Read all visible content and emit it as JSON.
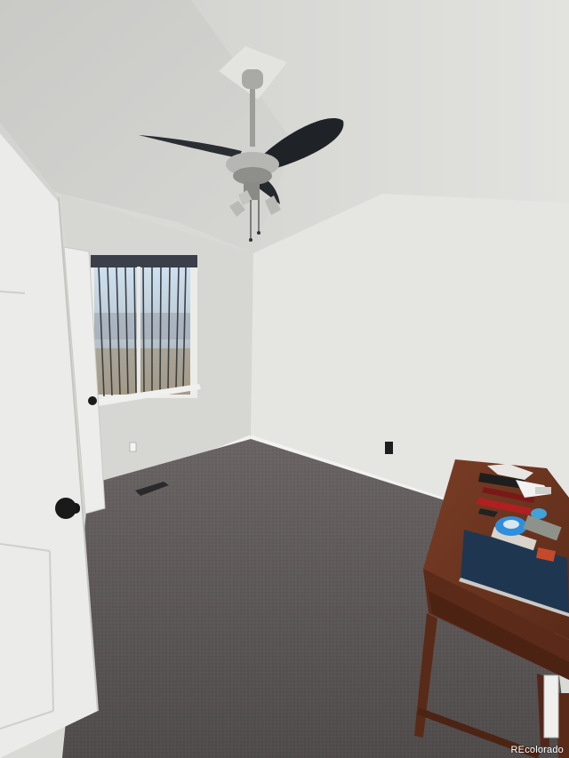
{
  "watermark": "REcolorado",
  "colors": {
    "ceiling": "#d2d2cf",
    "wall_left": "#d8d8d5",
    "wall_right": "#e6e6e3",
    "carpet": "#5e5a59",
    "door": "#ececea",
    "desk_wood": "#6b3420",
    "fan_blade": "#1f2226"
  }
}
